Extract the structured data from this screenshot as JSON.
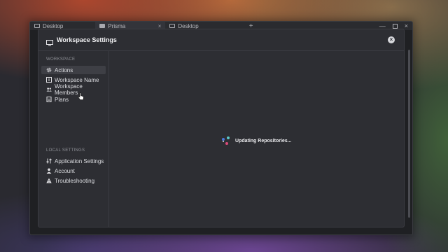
{
  "tabs": [
    {
      "label": "Desktop",
      "icon": "monitor-icon"
    },
    {
      "label": "Prisma",
      "icon": "folder-icon"
    },
    {
      "label": "Desktop",
      "icon": "monitor-icon"
    }
  ],
  "tab_close": "×",
  "tab_add": "+",
  "window_controls": {
    "minimize": "—",
    "close": "×"
  },
  "dialog": {
    "title": "Workspace Settings",
    "close_icon": "close-circle-icon",
    "close_glyph": "×"
  },
  "sidebar": {
    "workspace_label": "WORKSPACE",
    "workspace_items": [
      {
        "label": "Actions",
        "icon": "gear-icon",
        "active": true
      },
      {
        "label": "Workspace Name",
        "icon": "text-cursor-icon"
      },
      {
        "label": "Workspace Members",
        "icon": "users-icon"
      },
      {
        "label": "Plans",
        "icon": "document-icon"
      }
    ],
    "local_label": "LOCAL SETTINGS",
    "local_items": [
      {
        "label": "Application Settings",
        "icon": "sliders-icon"
      },
      {
        "label": "Account",
        "icon": "person-icon"
      },
      {
        "label": "Troubleshooting",
        "icon": "warning-icon"
      }
    ]
  },
  "main": {
    "status_text": "Updating Repositories...",
    "spinner_colors": [
      "#5ac8c8",
      "#d94a7a",
      "#4a7ad9",
      "#e0e0e0"
    ]
  }
}
